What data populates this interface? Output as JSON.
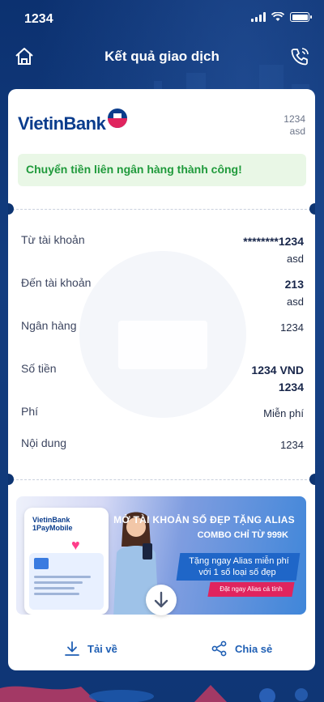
{
  "status_bar": {
    "time": "1234"
  },
  "nav": {
    "title": "Kết quả giao dịch"
  },
  "brand": {
    "name": "VietinBank"
  },
  "header": {
    "code_line1": "1234",
    "code_line2": "asd"
  },
  "success_message": "Chuyển tiền liên ngân hàng thành công!",
  "details": {
    "from_account": {
      "label": "Từ tài khoản",
      "value": "********1234",
      "sub": "asd"
    },
    "to_account": {
      "label": "Đến tài khoản",
      "value": "213",
      "sub": "asd"
    },
    "bank": {
      "label": "Ngân hàng",
      "value": "1234"
    },
    "amount": {
      "label": "Số tiền",
      "value": "1234 VND",
      "sub": "1234"
    },
    "fee": {
      "label": "Phí",
      "value": "Miễn phí"
    },
    "content": {
      "label": "Nội dung",
      "value": "1234"
    }
  },
  "banner": {
    "phone_brand_line1": "VietinBank",
    "phone_brand_line2": "1PayMobile",
    "title_line1": "MỞ TÀI KHOẢN SỐ ĐẸP TẶNG ALIAS",
    "title_line2": "COMBO CHỈ TỪ 999K",
    "offer_line1": "Tặng ngay Alias miễn phí",
    "offer_line2": "với 1 số loại số đẹp",
    "cta": "Đặt ngay Alias cá tính"
  },
  "footer": {
    "download_label": "Tải về",
    "share_label": "Chia sẻ"
  },
  "colors": {
    "primary": "#0e3572",
    "accent": "#1f5fb4",
    "success": "#1f9a3b",
    "brand_red": "#e0245e"
  }
}
